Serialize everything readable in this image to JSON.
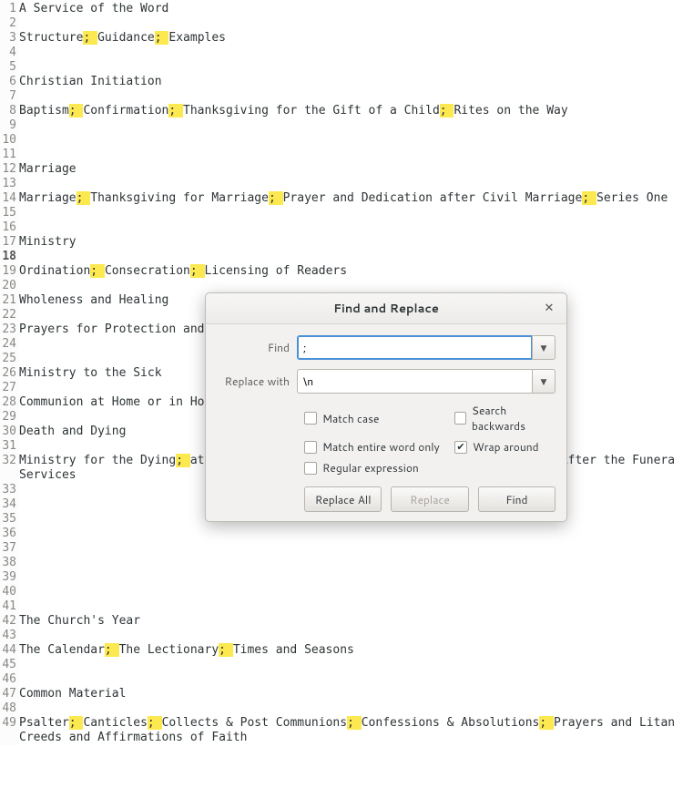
{
  "editor": {
    "current_line": 18,
    "lines": [
      {
        "n": 1,
        "segs": [
          "A Service of the Word"
        ]
      },
      {
        "n": 2,
        "segs": [
          ""
        ]
      },
      {
        "n": 3,
        "segs": [
          "Structure",
          "; ",
          "Guidance",
          "; ",
          "Examples"
        ]
      },
      {
        "n": 4,
        "segs": [
          ""
        ]
      },
      {
        "n": 5,
        "segs": [
          ""
        ]
      },
      {
        "n": 6,
        "segs": [
          "Christian Initiation"
        ]
      },
      {
        "n": 7,
        "segs": [
          ""
        ]
      },
      {
        "n": 8,
        "segs": [
          "Baptism",
          "; ",
          "Confirmation",
          "; ",
          "Thanksgiving for the Gift of a Child",
          "; ",
          "Rites on the Way"
        ]
      },
      {
        "n": 9,
        "segs": [
          ""
        ]
      },
      {
        "n": 10,
        "segs": [
          ""
        ]
      },
      {
        "n": 11,
        "segs": [
          ""
        ]
      },
      {
        "n": 12,
        "segs": [
          "Marriage"
        ]
      },
      {
        "n": 13,
        "segs": [
          ""
        ]
      },
      {
        "n": 14,
        "segs": [
          "Marriage",
          "; ",
          "Thanksgiving for Marriage",
          "; ",
          "Prayer and Dedication after Civil Marriage",
          "; ",
          "Series One"
        ]
      },
      {
        "n": 15,
        "segs": [
          ""
        ]
      },
      {
        "n": 16,
        "segs": [
          ""
        ]
      },
      {
        "n": 17,
        "segs": [
          "Ministry"
        ]
      },
      {
        "n": 18,
        "segs": [
          ""
        ]
      },
      {
        "n": 19,
        "segs": [
          "Ordination",
          "; ",
          "Consecration",
          "; ",
          "Licensing of Readers"
        ]
      },
      {
        "n": 20,
        "segs": [
          ""
        ]
      },
      {
        "n": 21,
        "segs": [
          "Wholeness and Healing"
        ]
      },
      {
        "n": 22,
        "segs": [
          ""
        ]
      },
      {
        "n": 23,
        "segs": [
          "Prayers for Protection and                                                 "
        ]
      },
      {
        "n": 24,
        "segs": [
          ""
        ]
      },
      {
        "n": 25,
        "segs": [
          ""
        ]
      },
      {
        "n": 26,
        "segs": [
          "Ministry to the Sick"
        ]
      },
      {
        "n": 27,
        "segs": [
          ""
        ]
      },
      {
        "n": 28,
        "segs": [
          "Communion at Home or in Ho                                                 "
        ]
      },
      {
        "n": 29,
        "segs": [
          ""
        ]
      },
      {
        "n": 30,
        "segs": [
          "Death and Dying"
        ]
      },
      {
        "n": 31,
        "segs": [
          ""
        ]
      },
      {
        "n": 32,
        "segs": [
          "Ministry for the Dying",
          "; ",
          "at                                                  After the Funera"
        ]
      },
      {
        "n": 0,
        "segs": [
          "Services"
        ],
        "wrap": true
      },
      {
        "n": 33,
        "segs": [
          ""
        ]
      },
      {
        "n": 34,
        "segs": [
          ""
        ]
      },
      {
        "n": 35,
        "segs": [
          ""
        ]
      },
      {
        "n": 36,
        "segs": [
          ""
        ]
      },
      {
        "n": 37,
        "segs": [
          ""
        ]
      },
      {
        "n": 38,
        "segs": [
          ""
        ]
      },
      {
        "n": 39,
        "segs": [
          ""
        ]
      },
      {
        "n": 40,
        "segs": [
          ""
        ]
      },
      {
        "n": 41,
        "segs": [
          ""
        ]
      },
      {
        "n": 42,
        "segs": [
          "The Church's Year"
        ]
      },
      {
        "n": 43,
        "segs": [
          ""
        ]
      },
      {
        "n": 44,
        "segs": [
          "The Calendar",
          "; ",
          "The Lectionary",
          "; ",
          "Times and Seasons"
        ]
      },
      {
        "n": 45,
        "segs": [
          ""
        ]
      },
      {
        "n": 46,
        "segs": [
          ""
        ]
      },
      {
        "n": 47,
        "segs": [
          "Common Material"
        ]
      },
      {
        "n": 48,
        "segs": [
          ""
        ]
      },
      {
        "n": 49,
        "segs": [
          "Psalter",
          "; ",
          "Canticles",
          "; ",
          "Collects & Post Communions",
          "; ",
          "Confessions & Absolutions",
          "; ",
          "Prayers and Litan"
        ]
      },
      {
        "n": 0,
        "segs": [
          "Creeds and Affirmations of Faith"
        ],
        "wrap": true
      }
    ]
  },
  "dialog": {
    "title": "Find and Replace",
    "find_label": "Find",
    "find_value": ";",
    "replace_label": "Replace with",
    "replace_value": "\\n",
    "opt_match_case": "Match case",
    "opt_search_backwards": "Search backwards",
    "opt_match_word": "Match entire word only",
    "opt_wrap": "Wrap around",
    "opt_regex": "Regular expression",
    "btn_replace_all": "Replace All",
    "btn_replace": "Replace",
    "btn_find": "Find",
    "close": "✕",
    "chevron": "▼",
    "checked": {
      "match_case": false,
      "backwards": false,
      "word": false,
      "wrap": true,
      "regex": false
    }
  }
}
